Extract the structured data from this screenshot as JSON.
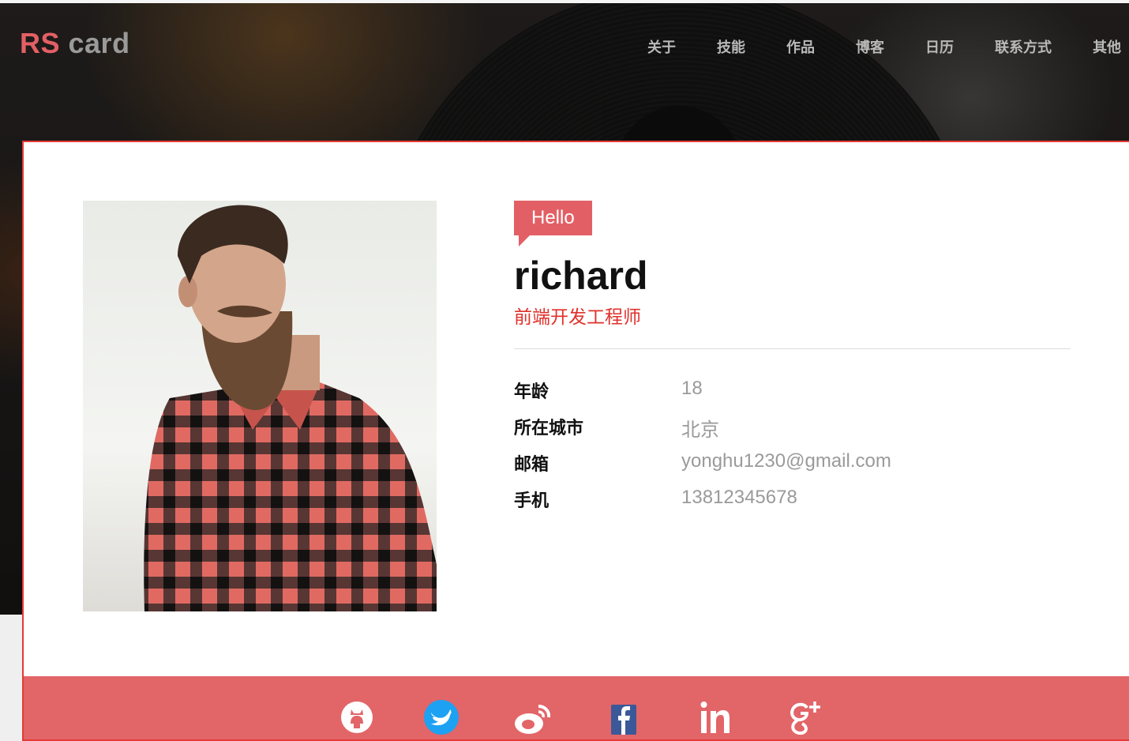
{
  "logo": {
    "part1": "RS",
    "part2": " card"
  },
  "nav": [
    "关于",
    "技能",
    "作品",
    "博客",
    "日历",
    "联系方式",
    "其他"
  ],
  "profile": {
    "greeting": "Hello",
    "name": "richard",
    "title": "前端开发工程师",
    "info": [
      {
        "label": "年龄",
        "value": "18"
      },
      {
        "label": "所在城市",
        "value": "北京"
      },
      {
        "label": "邮箱",
        "value": "yonghu1230@gmail.com"
      },
      {
        "label": "手机",
        "value": "13812345678"
      }
    ]
  },
  "social": [
    "github-icon",
    "twitter-icon",
    "weibo-icon",
    "facebook-icon",
    "linkedin-icon",
    "google-plus-icon"
  ],
  "colors": {
    "accent": "#e26065",
    "border": "#e53935",
    "title_red": "#e0312b"
  }
}
